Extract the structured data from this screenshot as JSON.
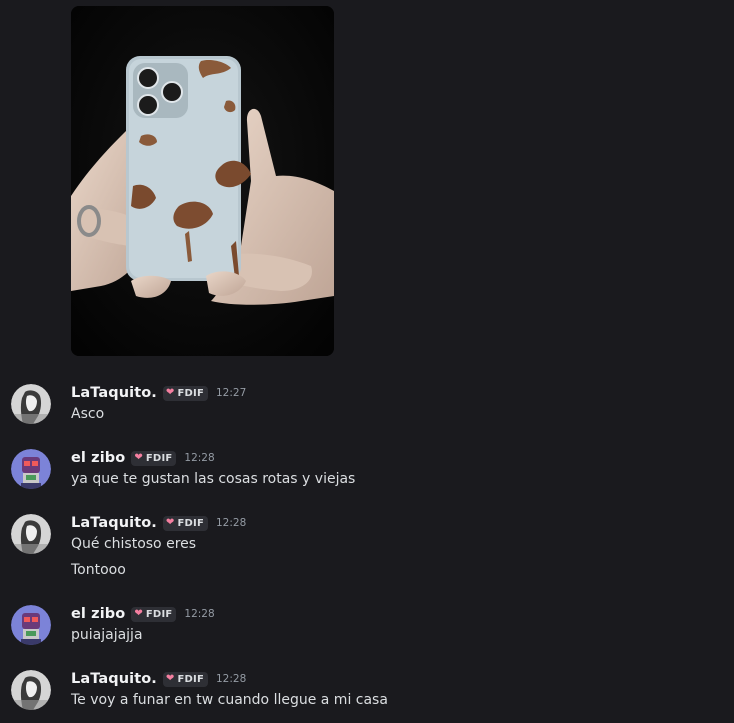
{
  "attachment": {
    "description_icon": "phone-photo-image"
  },
  "messages": [
    {
      "author": "LaTaquito.",
      "tag": "FDIF",
      "time": "12:27",
      "lines": [
        "Asco"
      ]
    },
    {
      "author": "el zibo",
      "tag": "FDIF",
      "time": "12:28",
      "lines": [
        "ya que te gustan las cosas rotas y viejas"
      ]
    },
    {
      "author": "LaTaquito.",
      "tag": "FDIF",
      "time": "12:28",
      "lines": [
        "Qué chistoso eres",
        "Tontooo"
      ]
    },
    {
      "author": "el zibo",
      "tag": "FDIF",
      "time": "12:28",
      "lines": [
        "puiajajajja"
      ]
    },
    {
      "author": "LaTaquito.",
      "tag": "FDIF",
      "time": "12:28",
      "lines": [
        "Te voy a funar en tw cuando llegue a mi casa"
      ]
    }
  ]
}
